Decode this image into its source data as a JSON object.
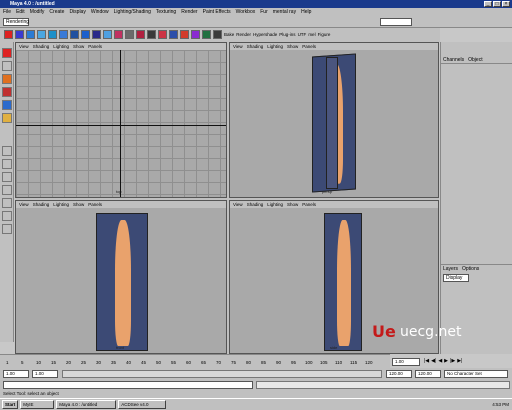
{
  "window": {
    "title": "Maya 4.0 : /untitled"
  },
  "menu": [
    "File",
    "Edit",
    "Modify",
    "Create",
    "Display",
    "Window",
    "Lighting/Shading",
    "Texturing",
    "Render",
    "Paint Effects",
    "Workbox",
    "Fur",
    "mental ray",
    "Help"
  ],
  "statusline": {
    "mode": "Rendering"
  },
  "shelf": {
    "labels": [
      "Bake",
      "Render",
      "Hypershade",
      "Plug-ins",
      "UTF",
      "mel",
      "Figure"
    ]
  },
  "viewports": [
    {
      "menu": [
        "View",
        "Shading",
        "Lighting",
        "Show",
        "Panels"
      ],
      "camera": "top"
    },
    {
      "menu": [
        "View",
        "Shading",
        "Lighting",
        "Show",
        "Panels"
      ],
      "camera": "persp"
    },
    {
      "menu": [
        "View",
        "Shading",
        "Lighting",
        "Show",
        "Panels"
      ],
      "camera": "front"
    },
    {
      "menu": [
        "View",
        "Shading",
        "Lighting",
        "Show",
        "Panels"
      ],
      "camera": "side"
    }
  ],
  "channelbox": {
    "tabs": [
      "Channels",
      "Object"
    ]
  },
  "layers": {
    "tabs": [
      "Layers",
      "Options"
    ],
    "selected": "Display"
  },
  "timeline": {
    "ticks": [
      "1",
      "5",
      "10",
      "15",
      "20",
      "25",
      "30",
      "35",
      "40",
      "45",
      "50",
      "55",
      "60",
      "65",
      "70",
      "75",
      "80",
      "85",
      "90",
      "95",
      "100",
      "105",
      "110",
      "115",
      "120"
    ],
    "current": "1.00"
  },
  "range": {
    "start": "1.00",
    "start2": "1.00",
    "end": "120.00",
    "end2": "120.00",
    "character": "No Character Set"
  },
  "help": {
    "text": "Select Tool: select an object"
  },
  "taskbar": {
    "start": "Start",
    "tasks": [
      "MyIE",
      "Maya 4.0 : /untitled",
      "ACDSee v4.0"
    ],
    "clock": "4:53 PM"
  },
  "watermark": {
    "logo": "Ue",
    "text": "uecg.net"
  }
}
